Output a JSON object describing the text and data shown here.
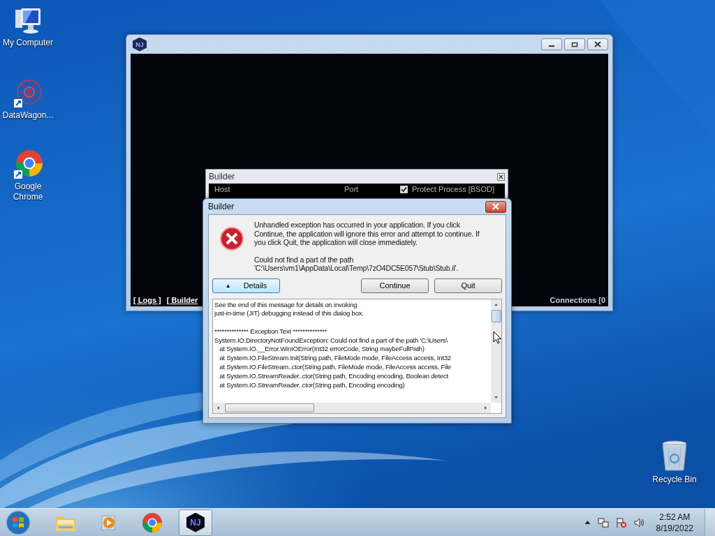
{
  "desktop": {
    "icons": [
      {
        "label": "My Computer",
        "kind": "computer"
      },
      {
        "label": "DataWagon...",
        "kind": "network"
      },
      {
        "label": "Google Chrome",
        "kind": "chrome"
      },
      {
        "label": "Recycle Bin",
        "kind": "bin"
      }
    ]
  },
  "main_window": {
    "logo_text": "NJ",
    "bottom_links": [
      "[ Logs ]",
      "[ Builder"
    ],
    "status": "Connections [0"
  },
  "builder_window": {
    "title": "Builder",
    "fields": [
      "Host",
      "Port"
    ],
    "checkbox": {
      "label": "Protect Process [BSOD]",
      "checked": true
    }
  },
  "error_dialog": {
    "title": "Builder",
    "message": "Unhandled exception has occurred in your application. If you click Continue, the application will ignore this error and attempt to continue. If you click Quit, the application will close immediately.",
    "path_lines": [
      "Could not find a part of the path",
      "'C:\\Users\\vm1\\AppData\\Local\\Temp\\7zO4DC5E057\\Stub\\Stub.il'."
    ],
    "details_button": {
      "glyph": "▲",
      "label": "Details"
    },
    "buttons": [
      "Continue",
      "Quit"
    ],
    "intro_lines": [
      "See the end of this message for details on invoking",
      "just-in-time (JIT) debugging instead of this dialog box."
    ],
    "details_lines": [
      "************** Exception Text **************",
      "System.IO.DirectoryNotFoundException: Could not find a part of the path 'C:\\Users\\",
      "   at System.IO.__Error.WinIOError(Int32 errorCode, String maybeFullPath)",
      "   at System.IO.FileStream.Init(String path, FileMode mode, FileAccess access, Int32",
      "   at System.IO.FileStream..ctor(String path, FileMode mode, FileAccess access, File",
      "   at System.IO.StreamReader..ctor(String path, Encoding encoding, Boolean detect",
      "   at System.IO.StreamReader..ctor(String path, Encoding encoding)"
    ]
  },
  "taskbar": {
    "apps": [
      {
        "kind": "explorer",
        "selected": false
      },
      {
        "kind": "media",
        "selected": false
      },
      {
        "kind": "chrome",
        "selected": false
      },
      {
        "kind": "nj",
        "label": "NJ",
        "selected": true
      }
    ],
    "clock": {
      "time": "2:52 AM",
      "date": "8/19/2022"
    }
  }
}
